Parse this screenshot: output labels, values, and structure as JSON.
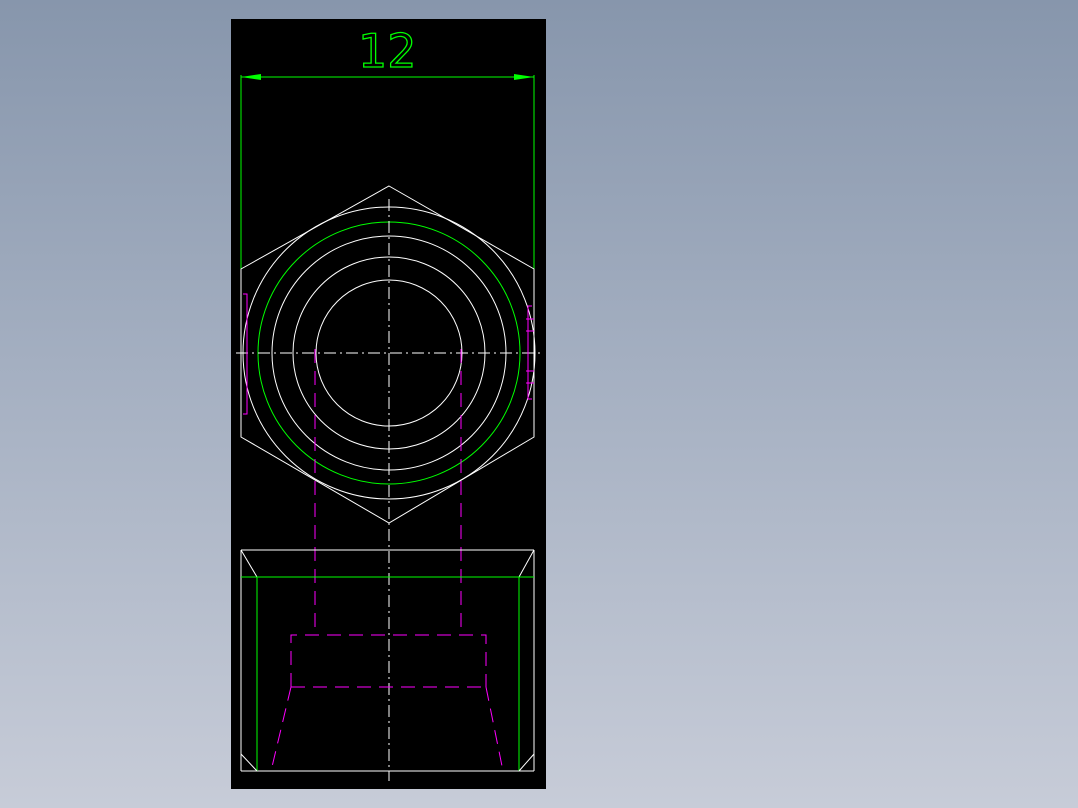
{
  "drawing": {
    "dimension_value": "12",
    "colors": {
      "background": "#000000",
      "outline": "#ffffff",
      "dimension": "#00ff00",
      "hidden": "#ff00ff",
      "viewport": "#8796ac"
    }
  }
}
